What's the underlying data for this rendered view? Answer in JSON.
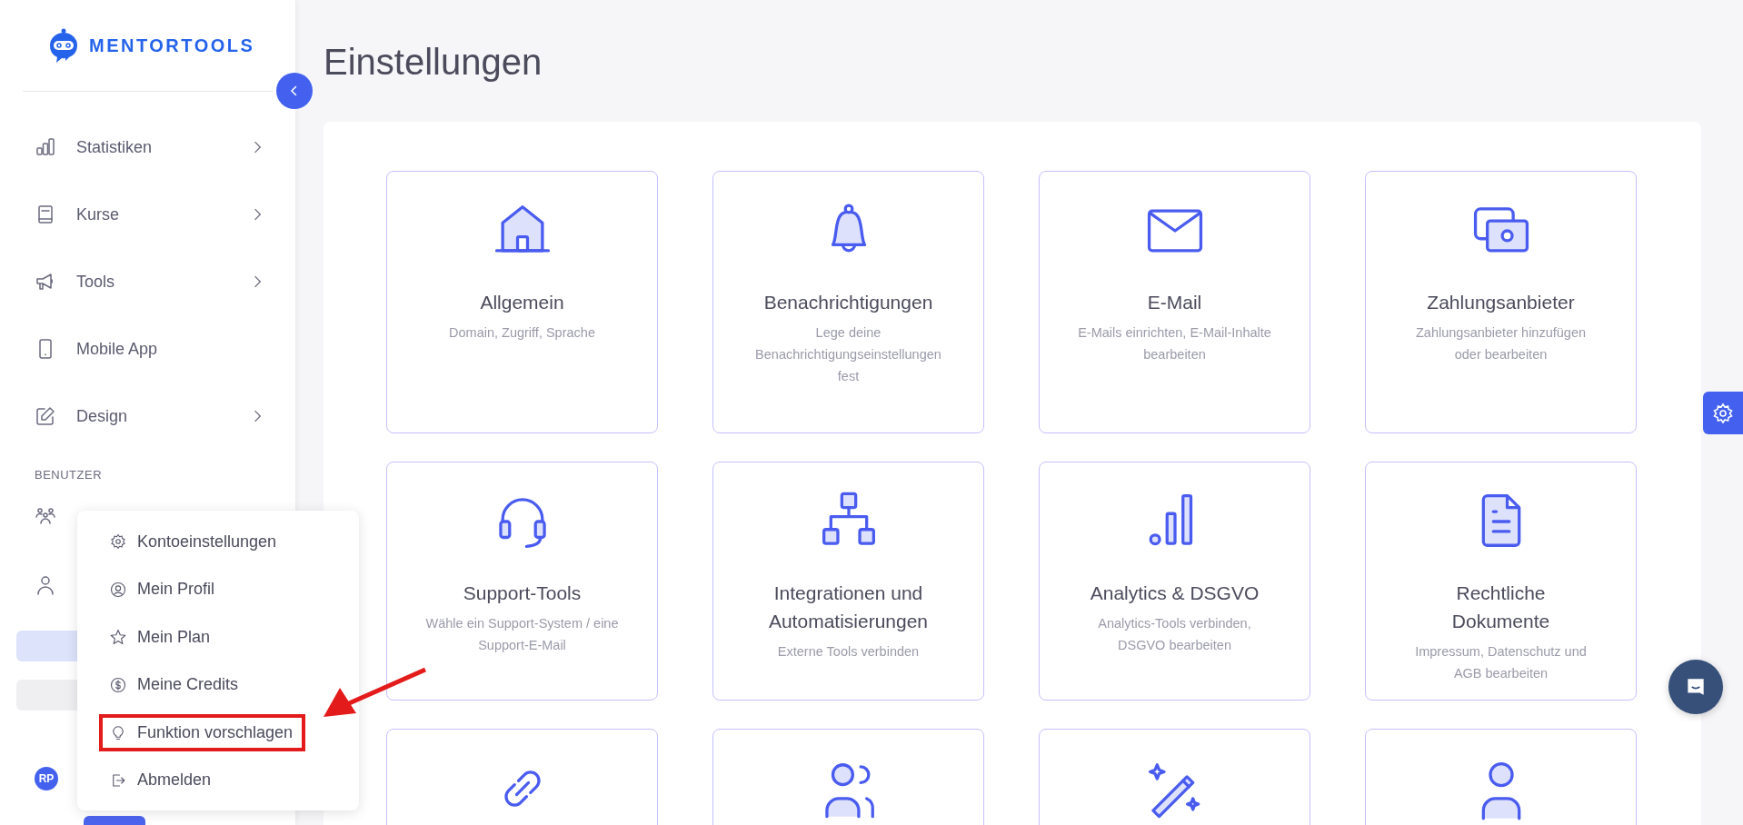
{
  "brand": {
    "name": "MENTORTOOLS"
  },
  "sidebar": {
    "items": [
      {
        "label": "Statistiken",
        "kind": "chart",
        "expandable": true
      },
      {
        "label": "Kurse",
        "kind": "book",
        "expandable": true
      },
      {
        "label": "Tools",
        "kind": "megaphone",
        "expandable": true
      },
      {
        "label": "Mobile App",
        "kind": "phone",
        "expandable": false
      },
      {
        "label": "Design",
        "kind": "pencil",
        "expandable": true
      }
    ],
    "section_label": "BENUTZER",
    "user_items": [
      {
        "kind": "users"
      },
      {
        "kind": "person"
      }
    ],
    "avatar": {
      "initials": "RP"
    }
  },
  "account_menu": {
    "items": [
      {
        "label": "Kontoeinstellungen",
        "kind": "gear",
        "annotated": false
      },
      {
        "label": "Mein Profil",
        "kind": "profile",
        "annotated": false
      },
      {
        "label": "Mein Plan",
        "kind": "star",
        "annotated": false
      },
      {
        "label": "Meine Credits",
        "kind": "coin",
        "annotated": false
      },
      {
        "label": "Funktion vorschlagen",
        "kind": "bulb",
        "annotated": true
      },
      {
        "label": "Abmelden",
        "kind": "logout",
        "annotated": false
      }
    ]
  },
  "page": {
    "title": "Einstellungen"
  },
  "cards": [
    {
      "kind": "house",
      "title": "Allgemein",
      "description": "Domain, Zugriff, Sprache"
    },
    {
      "kind": "bell",
      "title": "Benachrichtigungen",
      "description": "Lege deine Benachrichtigungseinstellungen fest"
    },
    {
      "kind": "envelope",
      "title": "E-Mail",
      "description": "E-Mails einrichten, E-Mail-Inhalte bearbeiten"
    },
    {
      "kind": "money",
      "title": "Zahlungsanbieter",
      "description": "Zahlungsanbieter hinzufügen oder bearbeiten"
    },
    {
      "kind": "headset",
      "title": "Support-Tools",
      "description": "Wähle ein Support-System / eine Support-E-Mail"
    },
    {
      "kind": "sitemap",
      "title": "Integrationen und Automatisierungen",
      "description": "Externe Tools verbinden"
    },
    {
      "kind": "bars",
      "title": "Analytics & DSGVO",
      "description": "Analytics-Tools verbinden, DSGVO bearbeiten"
    },
    {
      "kind": "document",
      "title": "Rechtliche Dokumente",
      "description": "Impressum, Datenschutz und AGB bearbeiten"
    },
    {
      "kind": "link"
    },
    {
      "kind": "users"
    },
    {
      "kind": "wand"
    },
    {
      "kind": "person"
    }
  ]
}
